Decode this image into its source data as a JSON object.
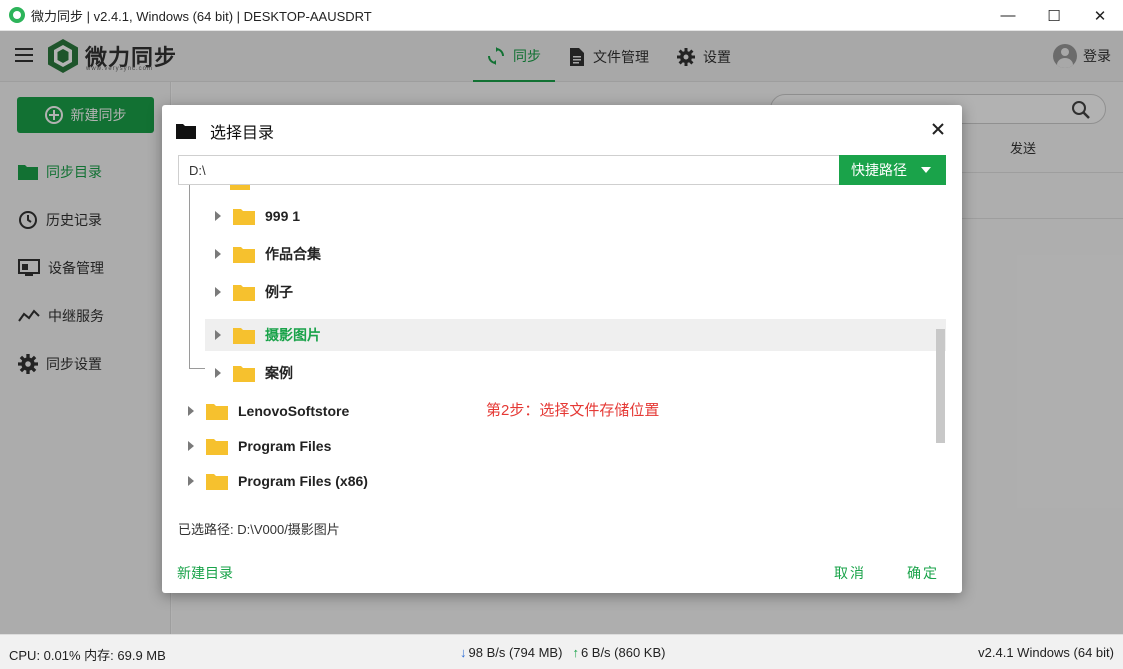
{
  "window": {
    "title": "微力同步 | v2.4.1, Windows (64 bit) | DESKTOP-AAUSDRT",
    "controls": [
      "—",
      "☐",
      "✕"
    ]
  },
  "header": {
    "brand": "微力同步",
    "brand_sub": "www.verysync.com",
    "tabs": [
      {
        "label": "同步",
        "active": true
      },
      {
        "label": "文件管理",
        "active": false
      },
      {
        "label": "设置",
        "active": false
      }
    ],
    "login": "登录"
  },
  "sidebar": {
    "new_sync": "新建同步",
    "items": [
      {
        "label": "同步目录",
        "active": true
      },
      {
        "label": "历史记录",
        "active": false
      },
      {
        "label": "设备管理",
        "active": false
      },
      {
        "label": "中继服务",
        "active": false
      },
      {
        "label": "同步设置",
        "active": false
      }
    ]
  },
  "main": {
    "column_send": "发送"
  },
  "dialog": {
    "title": "选择目录",
    "path_value": "D:\\",
    "quick_path": "快捷路径",
    "tree": [
      {
        "label": "999 1",
        "level": 2,
        "selected": false
      },
      {
        "label": "作品合集",
        "level": 2,
        "selected": false
      },
      {
        "label": "例子",
        "level": 2,
        "selected": false
      },
      {
        "label": "摄影图片",
        "level": 2,
        "selected": true
      },
      {
        "label": "案例",
        "level": 2,
        "selected": false
      },
      {
        "label": "LenovoSoftstore",
        "level": 1,
        "selected": false
      },
      {
        "label": "Program Files",
        "level": 1,
        "selected": false
      },
      {
        "label": "Program Files (x86)",
        "level": 1,
        "selected": false
      }
    ],
    "annotation": "第2步：选择文件存储位置",
    "selected_path": "已选路径: D:\\V000/摄影图片",
    "new_folder": "新建目录",
    "cancel": "取消",
    "ok": "确定"
  },
  "status": {
    "cpu_mem": "CPU: 0.01%  内存: 69.9 MB",
    "download": "98 B/s (794 MB)",
    "upload": "6 B/s (860 KB)",
    "version": "v2.4.1  Windows (64 bit)"
  },
  "colors": {
    "accent": "#1aa34a",
    "annotation": "#e53935",
    "folder": "#f6c12e"
  }
}
